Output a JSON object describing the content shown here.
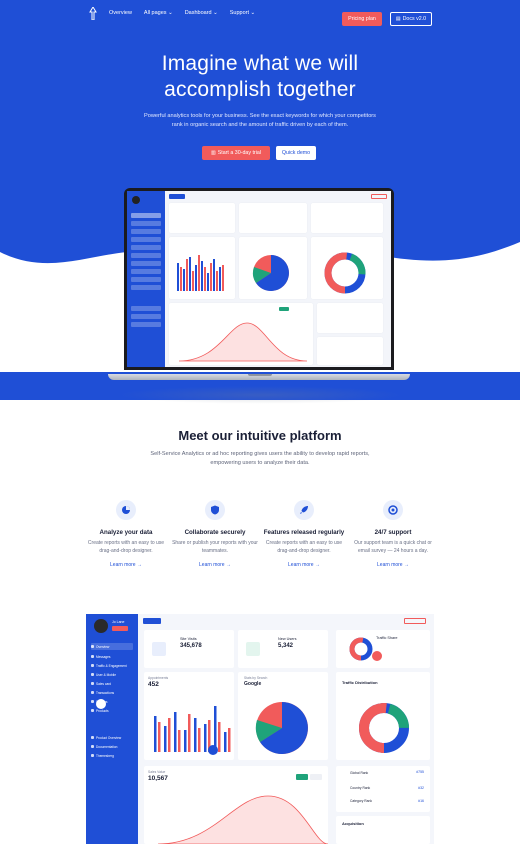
{
  "nav": {
    "links": [
      "Overview",
      "All pages",
      "Dashboard",
      "Support"
    ],
    "pricing_label": "Pricing plan",
    "docs_label": "Docs v2.0"
  },
  "hero": {
    "title_line1": "Imagine what we will",
    "title_line2": "accomplish together",
    "subtitle": "Powerful analytics tools for your business. See the exact keywords for which your competitors rank in organic search and the amount of traffic driven by each of them.",
    "trial_label": "Start a 30-day trial",
    "demo_label": "Quick demo"
  },
  "platform": {
    "title": "Meet our intuitive platform",
    "subtitle": "Self-Service Analytics or ad hoc reporting gives users the ability to develop rapid reports, empowering users to analyze their data."
  },
  "features": [
    {
      "title": "Analyze your data",
      "desc": "Create reports with an easy to use drag-and-drop designer.",
      "link": "Learn more"
    },
    {
      "title": "Collaborate securely",
      "desc": "Share or publish your reports with your teammates.",
      "link": "Learn more"
    },
    {
      "title": "Features released regularly",
      "desc": "Create reports with an easy to use drag-and-drop designer.",
      "link": "Learn more"
    },
    {
      "title": "24/7 support",
      "desc": "Our support team is a quick chat or email survey — 24 hours a day.",
      "link": "Learn more"
    }
  ],
  "dashboard": {
    "user_name": "Jo Lane",
    "side_items": [
      "Overview",
      "Messages",
      "Traffic & Engagement",
      "User & Mobile",
      "Sales card",
      "Transactions",
      "Settings",
      "Products",
      "Product Overview",
      "Documentation",
      "Themesberg"
    ],
    "site_visits_label": "Site Visits",
    "site_visits_value": "345,678",
    "new_users_label": "New Users",
    "new_users_value": "5,342",
    "traffic_share_label": "Traffic Share",
    "appointments_label": "Appointments",
    "appointments_value": "452",
    "search_engine_label": "Stats by Search",
    "search_engine_value": "Google",
    "traffic_distribution_label": "Traffic Distribution",
    "sales_label": "Sales Value",
    "sales_value": "10,567",
    "acquisition_label": "Acquisition",
    "top_label": "Global Rank",
    "top_value": "#755",
    "country_label": "Country Rank",
    "country_value": "#32",
    "category_label": "Category Rank",
    "category_value": "#16"
  },
  "colors": {
    "brand": "#1f4fd6",
    "accent_red": "#f15b5b",
    "green": "#1fa37a"
  }
}
